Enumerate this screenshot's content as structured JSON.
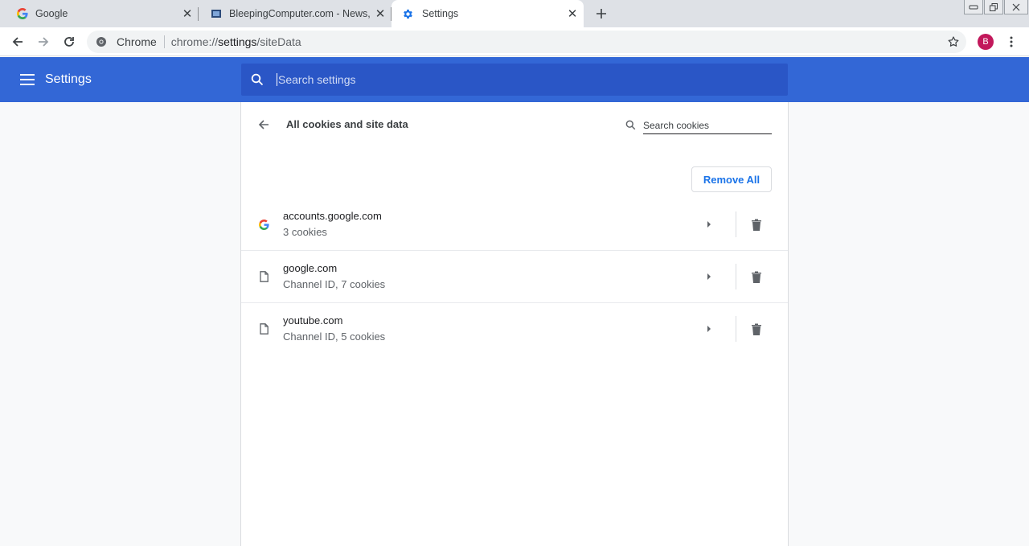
{
  "tabs": [
    {
      "title": "Google",
      "favicon": "google-g-icon",
      "active": false
    },
    {
      "title": "BleepingComputer.com - News, R",
      "favicon": "bleepingcomputer-icon",
      "active": false
    },
    {
      "title": "Settings",
      "favicon": "gear-icon",
      "active": true
    }
  ],
  "toolbar": {
    "chip_label": "Chrome",
    "url_scheme": "chrome://",
    "url_host": "settings",
    "url_path": "/siteData",
    "avatar_initial": "B"
  },
  "header": {
    "title": "Settings",
    "search_placeholder": "Search settings"
  },
  "page": {
    "title": "All cookies and site data",
    "cookie_search_placeholder": "Search cookies",
    "remove_all_label": "Remove All"
  },
  "sites": [
    {
      "name": "accounts.google.com",
      "detail": "3 cookies",
      "icon": "google-g-icon"
    },
    {
      "name": "google.com",
      "detail": "Channel ID, 7 cookies",
      "icon": "file-icon"
    },
    {
      "name": "youtube.com",
      "detail": "Channel ID, 5 cookies",
      "icon": "file-icon"
    }
  ],
  "colors": {
    "header_blue": "#3367d6",
    "search_blue": "#2a56c6",
    "accent_blue": "#1a73e8",
    "avatar": "#c2185b"
  }
}
